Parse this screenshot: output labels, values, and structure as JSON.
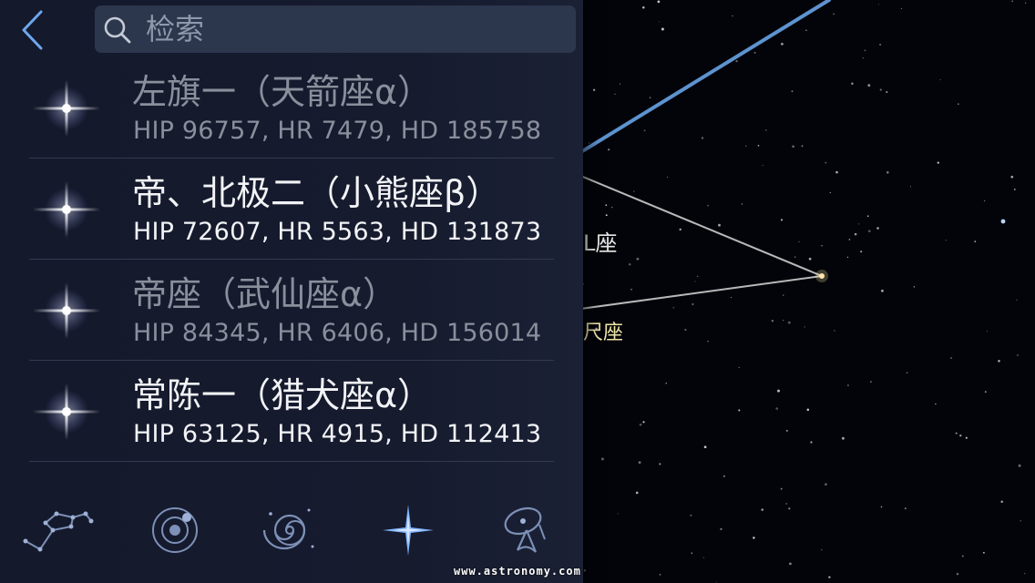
{
  "search": {
    "placeholder": "检索",
    "value": ""
  },
  "sky": {
    "labels": [
      "L座",
      "尺座"
    ]
  },
  "stars": [
    {
      "name": "左旗一（天箭座α）",
      "ids": "HIP 96757, HR 7479, HD 185758",
      "state": "dim"
    },
    {
      "name": "帝、北极二（小熊座β）",
      "ids": "HIP 72607, HR 5563, HD 131873",
      "state": "bright"
    },
    {
      "name": "帝座（武仙座α）",
      "ids": "HIP 84345, HR 6406, HD 156014",
      "state": "dim"
    },
    {
      "name": "常陈一（猎犬座α）",
      "ids": "HIP 63125, HR 4915, HD 112413",
      "state": "bright"
    }
  ],
  "tabs": [
    {
      "icon": "constellation-icon",
      "selected": false
    },
    {
      "icon": "solar-system-icon",
      "selected": false
    },
    {
      "icon": "galaxy-icon",
      "selected": false
    },
    {
      "icon": "star-icon",
      "selected": true
    },
    {
      "icon": "satellite-icon",
      "selected": false
    }
  ],
  "watermark": "www.astronomy.com",
  "colors": {
    "panel": "#161b2e",
    "search_bg": "#2c364d",
    "accent": "#7fb3ff",
    "dim_text": "#8a8f9c",
    "bright_text": "#f2f3f6"
  }
}
